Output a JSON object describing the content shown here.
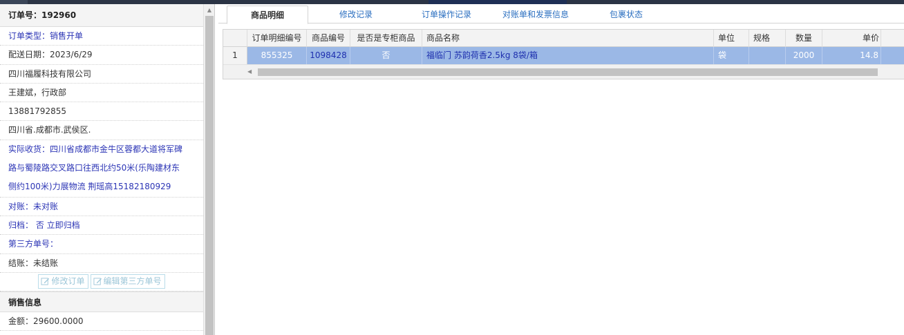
{
  "order": {
    "header": "订单号：192960",
    "fields": [
      {
        "text": "订单类型：销售开单",
        "style": "blue"
      },
      {
        "text": "配送日期：2023/6/29",
        "style": "dark"
      },
      {
        "text": "四川福履科技有限公司",
        "style": "dark"
      },
      {
        "text": "王建斌，行政部",
        "style": "dark"
      },
      {
        "text": "13881792855",
        "style": "dark"
      },
      {
        "text": "四川省.成都市.武侯区.",
        "style": "dark"
      }
    ],
    "address_lines": [
      "实际收货：四川省成都市金牛区蓉都大道将军碑",
      "路与蜀陵路交叉路口往西北约50米(乐陶建材东",
      "侧约100米)力展物流 荆瑶高15182180929"
    ],
    "fields2": [
      {
        "text": "对账：未对账",
        "style": "blue"
      },
      {
        "text": "归档： 否 立即归档",
        "style": "blue"
      },
      {
        "text": "第三方单号：",
        "style": "blue"
      },
      {
        "text": "结账：未结账",
        "style": "dark"
      }
    ],
    "edit_order_label": "修改订单",
    "edit_third_party_label": "编辑第三方单号"
  },
  "sales": {
    "header": "销售信息",
    "amount": "金额：29600.0000"
  },
  "tabs": [
    "商品明细",
    "修改记录",
    "订单操作记录",
    "对账单和发票信息",
    "包裹状态"
  ],
  "grid": {
    "columns": [
      "",
      "订单明细编号",
      "商品编号",
      "是否是专柜商品",
      "商品名称",
      "单位",
      "规格",
      "数量",
      "单价"
    ],
    "rows": [
      [
        "1",
        "855325",
        "1098428",
        "否",
        "福临门 苏韵荷香2.5kg 8袋/箱",
        "袋",
        "",
        "2000",
        "14.8"
      ]
    ]
  },
  "colors": {
    "selected_row": "#9bb8e6",
    "link_blue": "#2b34b5",
    "tab_blue": "#2b6fc0"
  }
}
